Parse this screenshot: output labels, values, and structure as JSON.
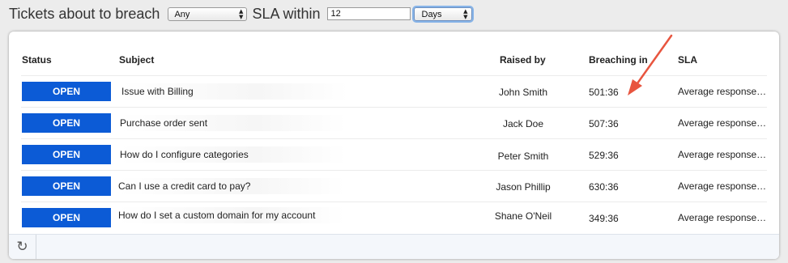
{
  "toolbar": {
    "title": "Tickets about to breach",
    "priority_select": "Any",
    "sla_label": "SLA within",
    "sla_value": "12",
    "unit_select": "Days"
  },
  "table": {
    "headers": {
      "status": "Status",
      "subject": "Subject",
      "raised_by": "Raised by",
      "breaching_in": "Breaching in",
      "sla": "SLA"
    },
    "rows": [
      {
        "status": "OPEN",
        "subject": "Issue with Billing",
        "raised_by": "John Smith",
        "breaching_in": "501:36",
        "sla": "Average response…"
      },
      {
        "status": "OPEN",
        "subject": "Purchase order sent",
        "raised_by": "Jack Doe",
        "breaching_in": "507:36",
        "sla": "Average response…"
      },
      {
        "status": "OPEN",
        "subject": "How do I configure categories",
        "raised_by": "Peter Smith",
        "breaching_in": "529:36",
        "sla": "Average response…"
      },
      {
        "status": "OPEN",
        "subject": "Can I use a credit card to pay?",
        "raised_by": "Jason Phillip",
        "breaching_in": "630:36",
        "sla": "Average response…"
      },
      {
        "status": "OPEN",
        "subject": "How do I set a custom domain for my account",
        "raised_by": "Shane O'Neil",
        "breaching_in": "349:36",
        "sla": "Average response…"
      }
    ]
  },
  "footer": {
    "refresh_icon": "refresh-icon"
  },
  "annotation": {
    "arrow_color": "#e8553f"
  },
  "colors": {
    "status_open": "#0c5bd6"
  }
}
